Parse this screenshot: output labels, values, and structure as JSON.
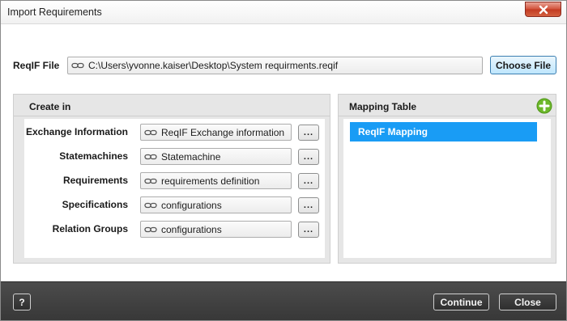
{
  "window": {
    "title": "Import Requirements"
  },
  "file": {
    "label": "ReqIF File",
    "path": "C:\\Users\\yvonne.kaiser\\Desktop\\System requirments.reqif",
    "choose_label": "Choose File"
  },
  "create_in": {
    "heading": "Create in",
    "browse_label": "...",
    "rows": [
      {
        "label": "Exchange Information",
        "value": "ReqIF Exchange information"
      },
      {
        "label": "Statemachines",
        "value": "Statemachine"
      },
      {
        "label": "Requirements",
        "value": "requirements definition"
      },
      {
        "label": "Specifications",
        "value": "configurations"
      },
      {
        "label": "Relation Groups",
        "value": "configurations"
      }
    ]
  },
  "mapping": {
    "heading": "Mapping Table",
    "items": [
      "ReqIF Mapping"
    ],
    "add_icon": "plus-circle-icon",
    "accent": "#199cf5"
  },
  "footer": {
    "help_label": "?",
    "continue_label": "Continue",
    "close_label": "Close"
  }
}
